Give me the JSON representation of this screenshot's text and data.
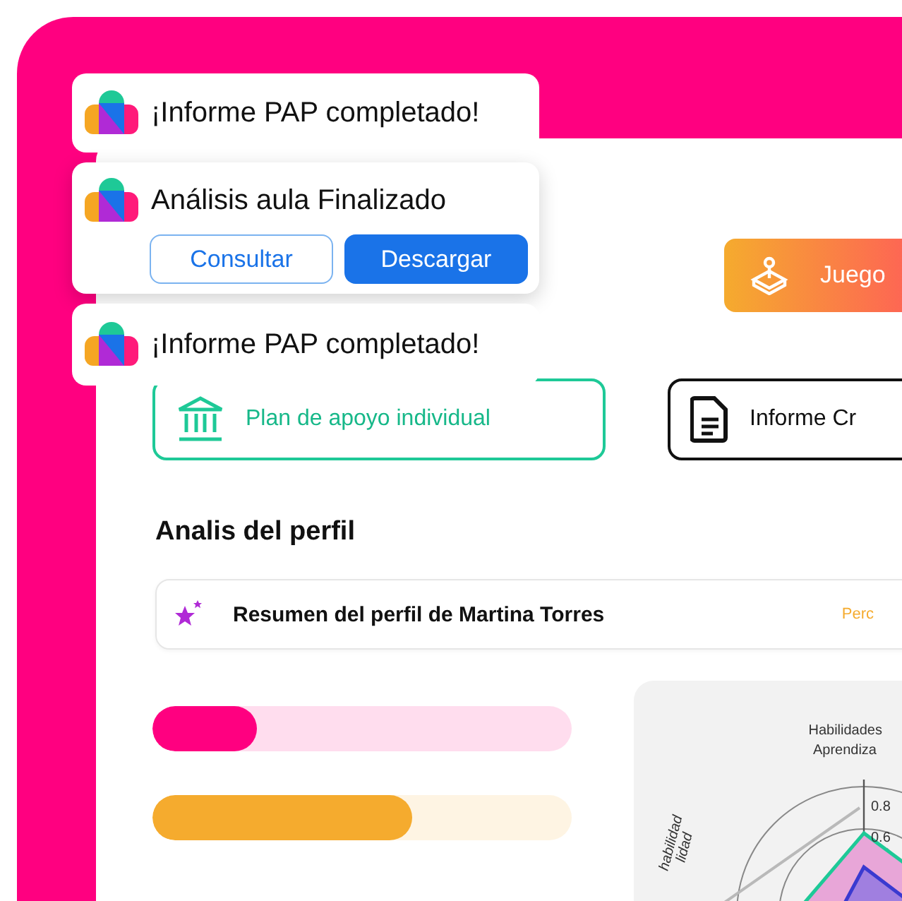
{
  "profile": {
    "game_button": "Juego",
    "tabs": [
      {
        "label": "Plan de apoyo individual",
        "selected": true
      },
      {
        "label": "Informe Cr",
        "selected": false
      }
    ],
    "section_title": "Analis del perfil",
    "summary": {
      "title": "Resumen del perfil de Martina Torres",
      "tag": "Perc"
    },
    "bars": [
      {
        "level": 0.25,
        "color": "#ff0080"
      },
      {
        "level": 0.62,
        "color": "#f5ab2e"
      }
    ],
    "radar": {
      "labels": [
        "Habilidades",
        "Aprendiza"
      ],
      "ticks": [
        "0.8",
        "0.6"
      ],
      "axis_labels": [
        "habilidad",
        "lidad"
      ]
    }
  },
  "toasts": [
    {
      "kind": "notice",
      "title": "¡Informe PAP completado!"
    },
    {
      "kind": "actions",
      "title": "Análisis aula Finalizado",
      "actions": [
        {
          "label": "Consultar",
          "primary": false
        },
        {
          "label": "Descargar",
          "primary": true
        }
      ]
    },
    {
      "kind": "notice",
      "title": "¡Informe PAP completado!"
    }
  ]
}
